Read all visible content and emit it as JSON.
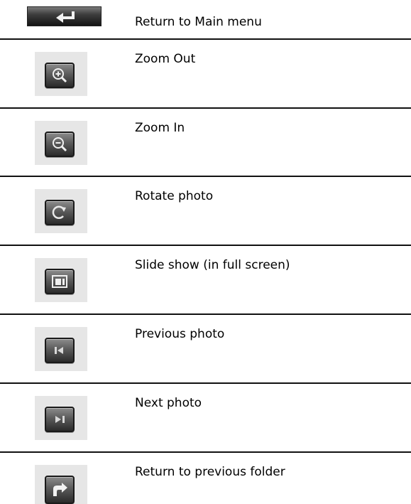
{
  "rows": [
    {
      "icon": "return-arrow-icon",
      "label": "Return to Main menu"
    },
    {
      "icon": "zoom-out-icon",
      "label": "Zoom Out"
    },
    {
      "icon": "zoom-in-icon",
      "label": "Zoom In"
    },
    {
      "icon": "rotate-icon",
      "label": "Rotate photo"
    },
    {
      "icon": "slideshow-icon",
      "label": "Slide show (in full screen)"
    },
    {
      "icon": "previous-icon",
      "label": "Previous photo"
    },
    {
      "icon": "next-icon",
      "label": "Next photo"
    },
    {
      "icon": "folder-return-icon",
      "label": "Return to previous folder"
    }
  ]
}
